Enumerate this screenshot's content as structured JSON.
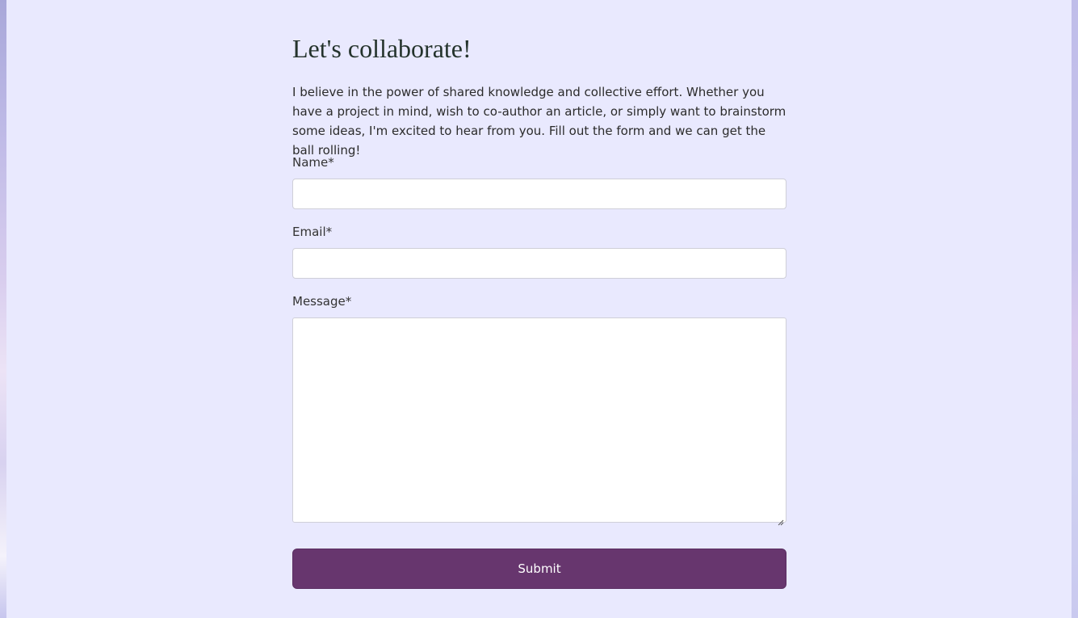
{
  "contact": {
    "heading": "Let's collaborate!",
    "intro": "I believe in the power of shared knowledge and collective effort. Whether you have a project in mind, wish to co-author an article, or simply want to brainstorm some ideas, I'm excited to hear from you. Fill out the form and we can get the ball rolling!",
    "fields": {
      "name": {
        "label": "Name*",
        "value": ""
      },
      "email": {
        "label": "Email*",
        "value": ""
      },
      "message": {
        "label": "Message*",
        "value": ""
      }
    },
    "submit_label": "Submit"
  },
  "colors": {
    "panel_background": "#e9e9fe",
    "heading_text": "#24332c",
    "submit_background": "#67366e",
    "submit_text": "#ffffff"
  },
  "icons": {
    "resize_handle": "textarea-resize-icon"
  }
}
